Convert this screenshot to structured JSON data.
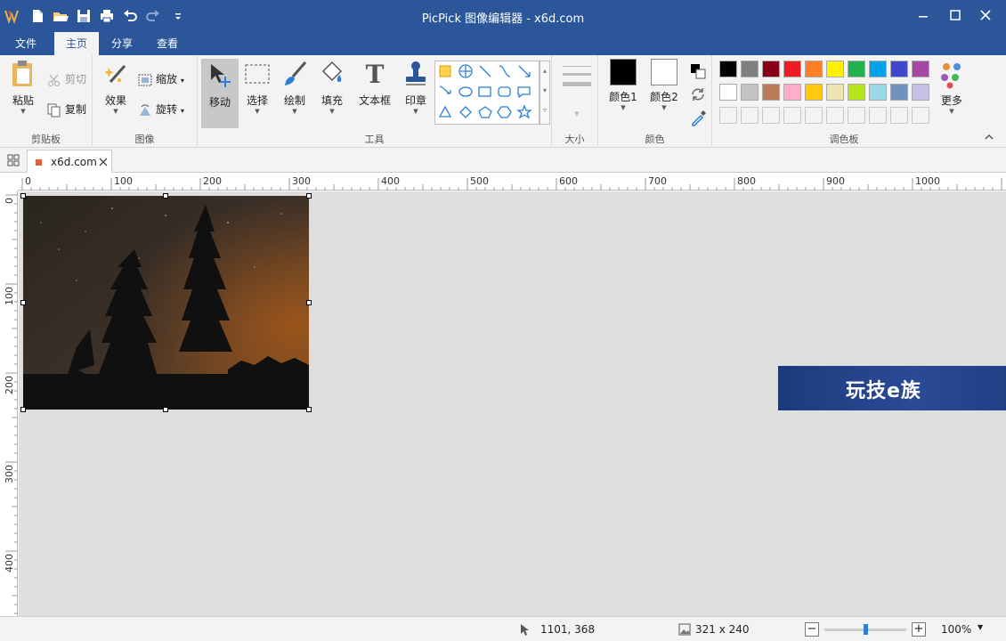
{
  "titlebar": {
    "title": "PicPick 图像编辑器 - x6d.com",
    "bg": "#2b579a"
  },
  "quick_access": [
    "app-logo-icon",
    "new-file-icon",
    "open-file-icon",
    "save-icon",
    "print-icon",
    "undo-icon",
    "redo-icon",
    "customize-icon"
  ],
  "menu_tabs": [
    {
      "label": "文件",
      "active": false
    },
    {
      "label": "主页",
      "active": true
    },
    {
      "label": "分享",
      "active": false
    },
    {
      "label": "查看",
      "active": false
    }
  ],
  "ribbon": {
    "clipboard": {
      "paste": "粘贴",
      "cut": "剪切",
      "copy": "复制",
      "group": "剪贴板"
    },
    "image": {
      "effects": "效果",
      "resize": "缩放",
      "rotate": "旋转",
      "group": "图像"
    },
    "tools": {
      "move": "移动",
      "select": "选择",
      "draw": "绘制",
      "fill": "填充",
      "textbox": "文本框",
      "stamp": "印章",
      "group": "工具"
    },
    "size": {
      "group": "大小"
    },
    "colors": {
      "color1": "颜色1",
      "color2": "颜色2",
      "group": "颜色"
    },
    "palette": {
      "group": "调色板",
      "more": "更多",
      "row1": [
        "#000000",
        "#7f7f7f",
        "#880015",
        "#ed1c24",
        "#ff7f27",
        "#fff200",
        "#22b14c",
        "#00a2e8",
        "#3f48cc",
        "#a349a4"
      ],
      "row2": [
        "#ffffff",
        "#c3c3c3",
        "#b97a57",
        "#ffaec9",
        "#ffc90e",
        "#efe4b0",
        "#b5e61d",
        "#99d9ea",
        "#7092be",
        "#c8bfe7"
      ],
      "row3": [
        "#f3f3f3",
        "#f3f3f3",
        "#f3f3f3",
        "#f3f3f3",
        "#f3f3f3",
        "#f3f3f3",
        "#f3f3f3",
        "#f3f3f3",
        "#f3f3f3",
        "#f3f3f3"
      ]
    }
  },
  "document_tab": {
    "label": "x6d.com"
  },
  "rulers": {
    "h_labels": [
      "0",
      "100",
      "200",
      "300",
      "400",
      "500",
      "600",
      "700",
      "800",
      "900",
      "1000"
    ],
    "v_labels": [
      "0",
      "100",
      "200",
      "300",
      "400"
    ]
  },
  "watermark": {
    "text": "玩技e族"
  },
  "status": {
    "cursor": "1101, 368",
    "image_size": "321 x 240",
    "zoom": "100%",
    "zoom_fraction": 0.5
  }
}
